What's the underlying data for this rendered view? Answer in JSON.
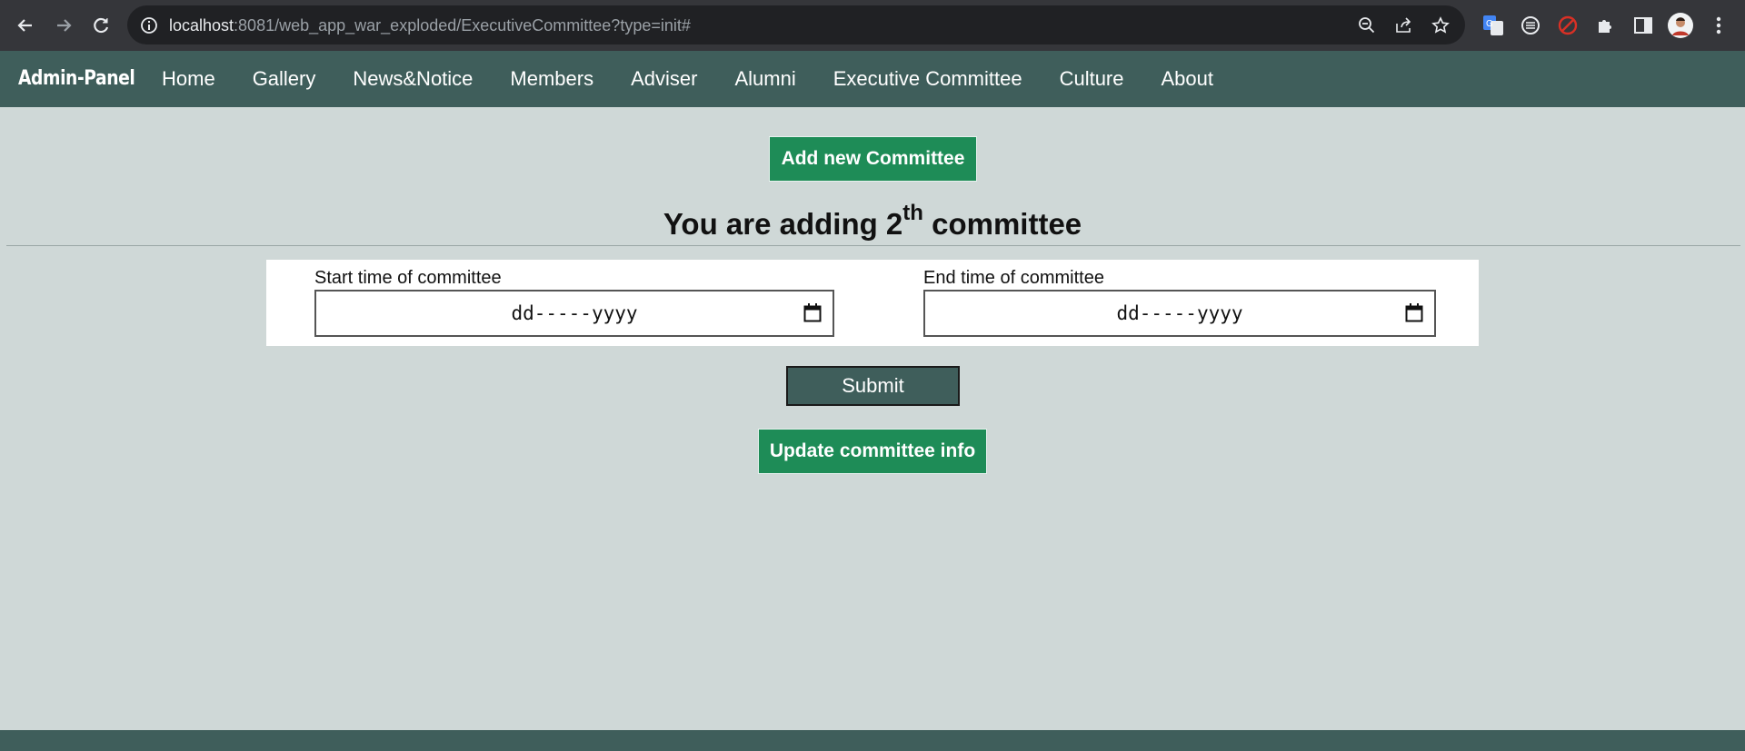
{
  "browser": {
    "url_host": "localhost",
    "url_rest": ":8081/web_app_war_exploded/ExecutiveCommittee?type=init#",
    "icons": [
      "back-icon",
      "forward-icon",
      "reload-icon",
      "info-icon",
      "zoom-icon",
      "share-icon",
      "star-icon",
      "translate-icon",
      "extension-reader-icon",
      "block-icon",
      "puzzle-icon",
      "sidepanel-icon",
      "avatar",
      "menu-icon"
    ]
  },
  "navbar": {
    "brand": "Admin-Panel",
    "links": [
      "Home",
      "Gallery",
      "News&Notice",
      "Members",
      "Adviser",
      "Alumni",
      "Executive Committee",
      "Culture",
      "About"
    ]
  },
  "main": {
    "add_button": "Add new Committee",
    "heading_prefix": "You are adding 2",
    "heading_sup": "th",
    "heading_suffix": " committee",
    "start_label": "Start time of committee",
    "start_value": "dd-----yyyy",
    "end_label": "End time of committee",
    "end_value": "dd-----yyyy",
    "submit_label": "Submit",
    "update_button": "Update committee info"
  },
  "colors": {
    "navbar": "#3f5e5b",
    "background": "#cfd8d7",
    "green_button": "#1e8c57"
  }
}
